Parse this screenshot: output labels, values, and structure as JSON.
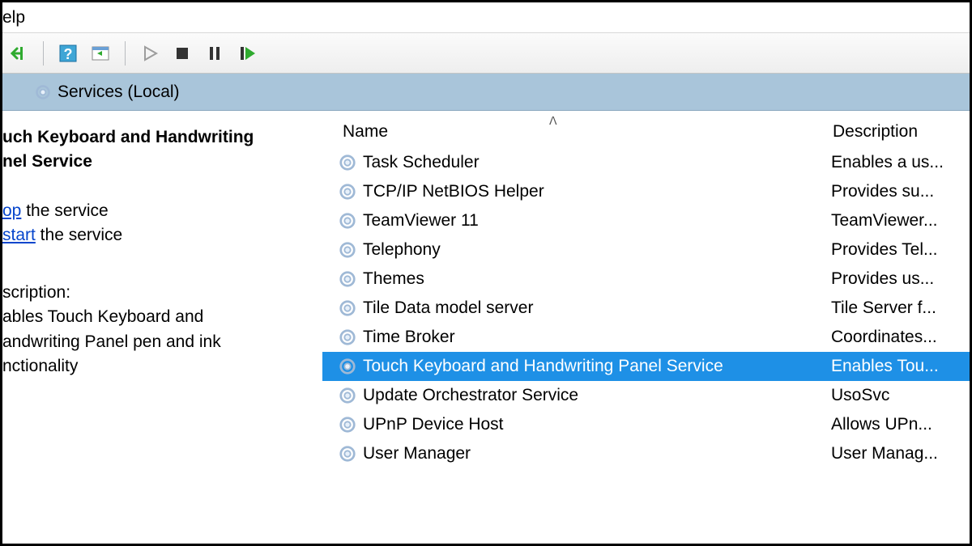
{
  "menubar": {
    "help": "elp"
  },
  "headerband": {
    "title": "Services (Local)"
  },
  "selected_service": {
    "title_line1": "uch Keyboard and Handwriting",
    "title_line2": "nel Service",
    "stop_link": "op",
    "stop_suffix": " the service",
    "restart_link": "start",
    "restart_suffix": " the service",
    "desc_label": "scription:",
    "desc_line1": "ables Touch Keyboard and",
    "desc_line2": "andwriting Panel pen and ink",
    "desc_line3": "nctionality"
  },
  "columns": {
    "name": "Name",
    "description": "Description",
    "sort": "ᐱ"
  },
  "services": [
    {
      "name": "Task Scheduler",
      "description": "Enables a us...",
      "selected": false
    },
    {
      "name": "TCP/IP NetBIOS Helper",
      "description": "Provides su...",
      "selected": false
    },
    {
      "name": "TeamViewer 11",
      "description": "TeamViewer...",
      "selected": false
    },
    {
      "name": "Telephony",
      "description": "Provides Tel...",
      "selected": false
    },
    {
      "name": "Themes",
      "description": "Provides us...",
      "selected": false
    },
    {
      "name": "Tile Data model server",
      "description": "Tile Server f...",
      "selected": false
    },
    {
      "name": "Time Broker",
      "description": "Coordinates...",
      "selected": false
    },
    {
      "name": "Touch Keyboard and Handwriting Panel Service",
      "description": "Enables Tou...",
      "selected": true
    },
    {
      "name": "Update Orchestrator Service",
      "description": "UsoSvc",
      "selected": false
    },
    {
      "name": "UPnP Device Host",
      "description": "Allows UPn...",
      "selected": false
    },
    {
      "name": "User Manager",
      "description": "User Manag...",
      "selected": false
    }
  ]
}
